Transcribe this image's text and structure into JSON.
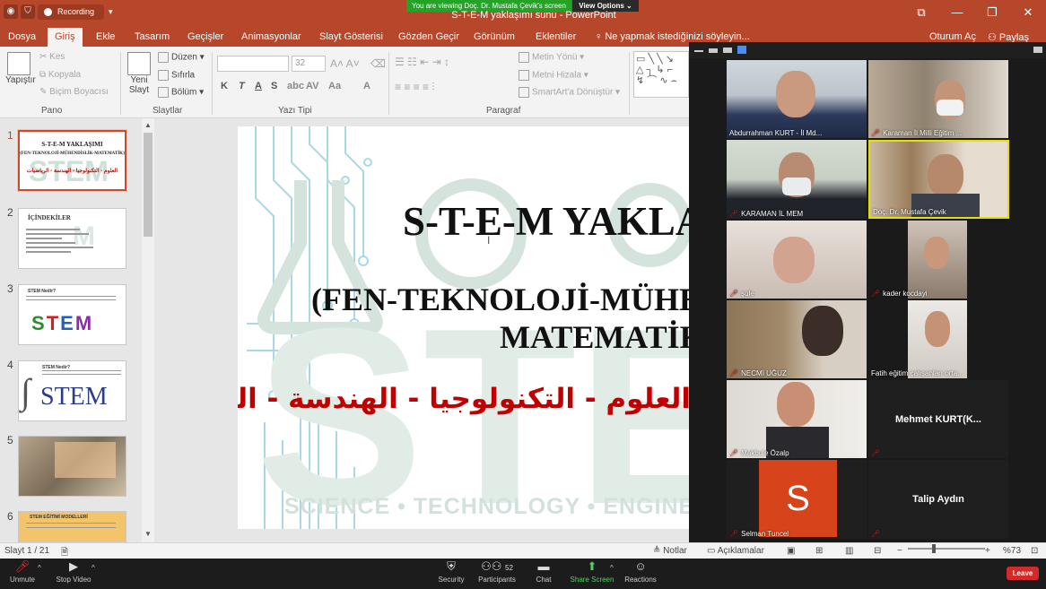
{
  "zoom": {
    "recording_label": "Recording",
    "viewing_banner": "You are viewing Doç. Dr. Mustafa Çevik's screen",
    "view_options": "View Options ⌄",
    "toolbar": [
      "Unmute",
      "Stop Video",
      "Security",
      "Participants",
      "Chat",
      "Share Screen",
      "Reactions"
    ],
    "participants_count": "52",
    "leave": "Leave",
    "participants": [
      {
        "name": "Abdurrahman KURT - İl Md...",
        "muted": false,
        "active": false
      },
      {
        "name": "Karaman İl Milli Eğitim ...",
        "muted": true,
        "active": false
      },
      {
        "name": "KARAMAN İL MEM",
        "muted": true,
        "active": false
      },
      {
        "name": "Doç. Dr. Mustafa Çevik",
        "muted": false,
        "active": true
      },
      {
        "name": "şule",
        "muted": true,
        "active": false
      },
      {
        "name": "kader kocdayi",
        "muted": true,
        "active": false
      },
      {
        "name": "NECMİ UĞUZ",
        "muted": true,
        "active": false
      },
      {
        "name": "Fatih eğitim çalışanları orta...",
        "muted": false,
        "active": false
      },
      {
        "name": "Makbule Özalp",
        "muted": true,
        "active": false
      },
      {
        "name": "Mehmet  KURT(K...",
        "muted": true,
        "active": false
      },
      {
        "name": "Selman Tuncel",
        "muted": true,
        "active": false,
        "avatar_letter": "S"
      },
      {
        "name": "Talip Aydın",
        "muted": true,
        "active": false
      }
    ]
  },
  "ppt": {
    "window_title": "S-T-E-M yaklaşımı sunu - PowerPoint",
    "tabs": [
      "Dosya",
      "Giriş",
      "Ekle",
      "Tasarım",
      "Geçişler",
      "Animasyonlar",
      "Slayt Gösterisi",
      "Gözden Geçir",
      "Görünüm",
      "Eklentiler"
    ],
    "tell_me": "Ne yapmak istediğinizi söyleyin...",
    "signin": "Oturum Aç",
    "share": "Paylaş",
    "ribbon": {
      "paste": "Yapıştır",
      "cut": "Kes",
      "copy": "Kopyala",
      "format_painter": "Biçim Boyacısı",
      "new_slide": "Yeni Slayt",
      "layout": "Düzen",
      "reset": "Sıfırla",
      "section": "Bölüm",
      "font_size": "32",
      "bold": "K",
      "italic": "T",
      "underline": "A",
      "strike": "S",
      "text_direction": "Metin Yönü",
      "align_text": "Metni Hizala",
      "smartart": "SmartArt'a Dönüştür",
      "groups": [
        "Pano",
        "Slaytlar",
        "Yazı Tipi",
        "Paragraf"
      ]
    },
    "slide": {
      "title": "S-T-E-M YAKLAŞIMI",
      "subtitle1": "(FEN-TEKNOLOJİ-MÜHENDİSLİK-",
      "subtitle2": "MATEMATİK)",
      "arabic": "العلوم - التكنولوجيا - الهندسة - الرياضيات",
      "footer": "SCIENCE • TECHNOLOGY • ENGINEERING • MATHEMATICS"
    },
    "thumbnails": [
      {
        "num": "1",
        "title": "S-T-E-M YAKLAŞIMI",
        "sub": "(FEN-TEKNOLOJİ-MÜHENDİSLİK-MATEMATİK)",
        "ar": "العلوم - التكنولوجيا - الهندسة - الرياضيات"
      },
      {
        "num": "2",
        "title": "İÇİNDEKİLER"
      },
      {
        "num": "3",
        "title": "STEM Nedir?"
      },
      {
        "num": "4",
        "title": "STEM Nedir?",
        "logo": "STEM"
      },
      {
        "num": "5"
      },
      {
        "num": "6",
        "title": "STEM EĞİTİMİ MODELLERİ"
      }
    ],
    "status": {
      "slide_counter": "Slayt 1 / 21",
      "notes": "Notlar",
      "comments": "Açıklamalar",
      "zoom": "%73"
    }
  }
}
